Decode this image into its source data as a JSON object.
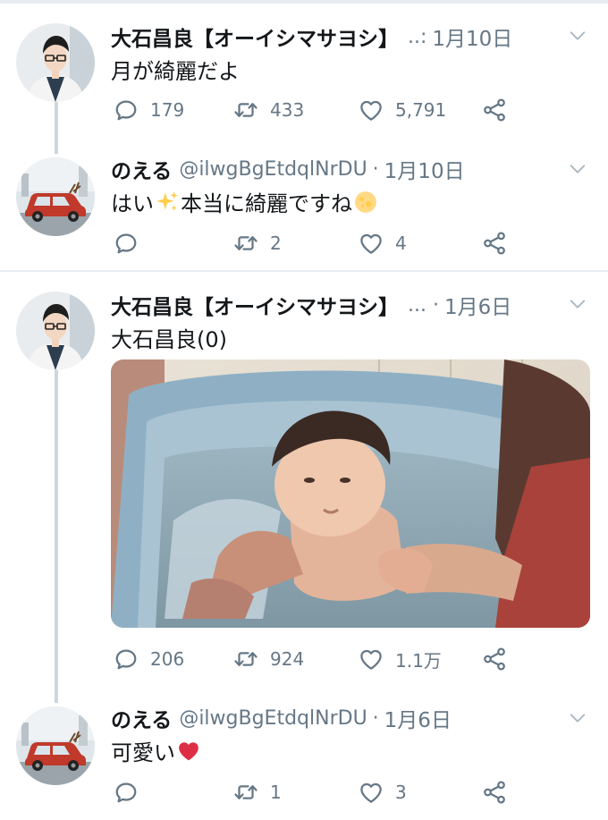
{
  "tweets": [
    {
      "name": "大石昌良【オーイシマサヨシ】",
      "handle": "",
      "ellipsis": "..:",
      "date": "1月10日",
      "text": "月が綺麗だよ",
      "reply_count": "179",
      "retweet_count": "433",
      "like_count": "5,791"
    },
    {
      "name": "のえる",
      "handle": "@ilwgBgEtdqlNrDU",
      "ellipsis": "·",
      "date": "1月10日",
      "text_before": "はい",
      "text_after": "本当に綺麗ですね",
      "reply_count": "",
      "retweet_count": "2",
      "like_count": "4"
    },
    {
      "name": "大石昌良【オーイシマサヨシ】",
      "handle": "",
      "ellipsis": "... ·",
      "date": "1月6日",
      "text": "大石昌良(0)",
      "reply_count": "206",
      "retweet_count": "924",
      "like_count": "1.1万"
    },
    {
      "name": "のえる",
      "handle": "@ilwgBgEtdqlNrDU",
      "ellipsis": "·",
      "date": "1月6日",
      "text": "可愛い",
      "reply_count": "",
      "retweet_count": "1",
      "like_count": "3"
    }
  ],
  "icons": {
    "reply": "reply-icon",
    "retweet": "retweet-icon",
    "like": "heart-icon",
    "share": "share-icon",
    "menu": "chevron-down-icon",
    "sparkles": "sparkles-emoji",
    "moon": "full-moon-emoji",
    "heart": "red-heart-emoji"
  },
  "colors": {
    "secondary_text": "#657786",
    "divider": "#e6ecf0",
    "thread_line": "#ccd6dd",
    "heart": "#e0245e",
    "sparkle": "#ffcc4d"
  }
}
